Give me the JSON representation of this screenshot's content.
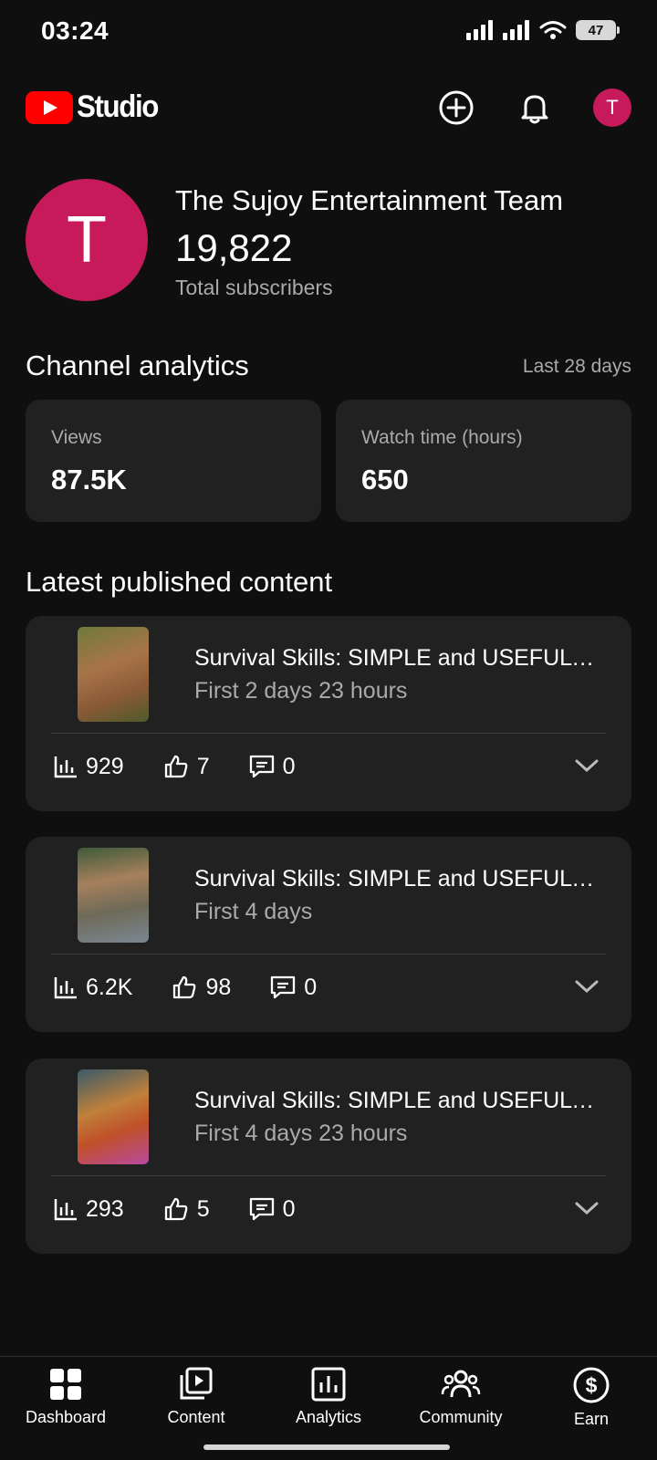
{
  "status_bar": {
    "time": "03:24",
    "battery": "47"
  },
  "header": {
    "logo_text": "Studio",
    "avatar_letter": "T"
  },
  "channel": {
    "avatar_letter": "T",
    "name": "The Sujoy Entertainment Team",
    "subscribers": "19,822",
    "subscribers_label": "Total subscribers"
  },
  "analytics": {
    "title": "Channel analytics",
    "range": "Last 28 days",
    "cards": [
      {
        "label": "Views",
        "value": "87.5K"
      },
      {
        "label": "Watch time (hours)",
        "value": "650"
      }
    ]
  },
  "latest": {
    "title": "Latest published content",
    "items": [
      {
        "title": "Survival Skills: SIMPLE and USEFUL …",
        "period": "First 2 days 23 hours",
        "views": "929",
        "likes": "7",
        "comments": "0"
      },
      {
        "title": "Survival Skills: SIMPLE and USEFUL …",
        "period": "First 4 days",
        "views": "6.2K",
        "likes": "98",
        "comments": "0"
      },
      {
        "title": "Survival Skills: SIMPLE and USEFUL …",
        "period": "First 4 days 23 hours",
        "views": "293",
        "likes": "5",
        "comments": "0"
      }
    ]
  },
  "nav": {
    "items": [
      {
        "label": "Dashboard",
        "icon": "dashboard-icon"
      },
      {
        "label": "Content",
        "icon": "content-icon"
      },
      {
        "label": "Analytics",
        "icon": "analytics-icon"
      },
      {
        "label": "Community",
        "icon": "community-icon"
      },
      {
        "label": "Earn",
        "icon": "earn-icon"
      }
    ]
  },
  "colors": {
    "background": "#0f0f0f",
    "card": "#212121",
    "accent_red": "#ff0000",
    "avatar": "#c71a5b",
    "secondary_text": "#aaaaaa"
  }
}
